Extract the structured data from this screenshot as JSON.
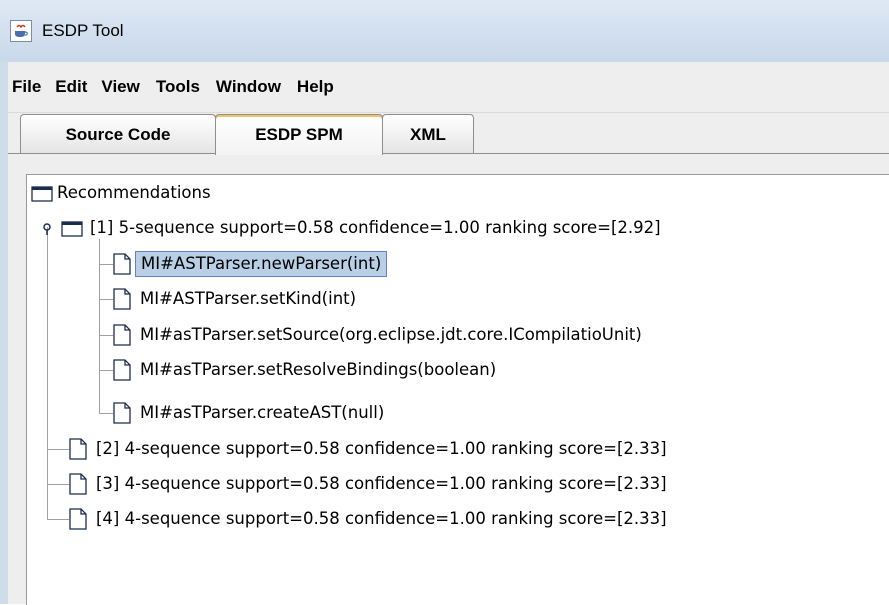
{
  "window": {
    "title": "ESDP Tool",
    "icon": "java-cup-icon"
  },
  "menu": {
    "items": [
      "File",
      "Edit",
      "View",
      "Tools",
      "Window",
      "Help"
    ]
  },
  "tabs": [
    {
      "label": "Source Code",
      "selected": false
    },
    {
      "label": "ESDP SPM",
      "selected": true
    },
    {
      "label": "XML",
      "selected": false
    }
  ],
  "tree": {
    "root": {
      "label": "Recommendations",
      "icon": "folder-icon"
    },
    "nodes": [
      {
        "label": "[1] 5-sequence support=0.58 confidence=1.00 ranking score=[2.92]",
        "icon": "folder-icon",
        "expanded": true,
        "children": [
          {
            "label": "MI#ASTParser.newParser(int)",
            "icon": "file-icon",
            "selected": true
          },
          {
            "label": "MI#ASTParser.setKind(int)",
            "icon": "file-icon"
          },
          {
            "label": "MI#asTParser.setSource(org.eclipse.jdt.core.ICompilatioUnit)",
            "icon": "file-icon"
          },
          {
            "label": "MI#asTParser.setResolveBindings(boolean)",
            "icon": "file-icon"
          },
          {
            "label": "MI#asTParser.createAST(null)",
            "icon": "file-icon"
          }
        ]
      },
      {
        "label": "[2] 4-sequence support=0.58 confidence=1.00 ranking score=[2.33]",
        "icon": "file-icon"
      },
      {
        "label": "[3] 4-sequence support=0.58 confidence=1.00 ranking score=[2.33]",
        "icon": "file-icon"
      },
      {
        "label": "[4] 4-sequence support=0.58 confidence=1.00 ranking score=[2.33]",
        "icon": "file-icon"
      }
    ]
  },
  "colors": {
    "selection_bg": "#b8cfe5",
    "selection_border": "#6382bf",
    "title_bar": "#d2dfee"
  }
}
